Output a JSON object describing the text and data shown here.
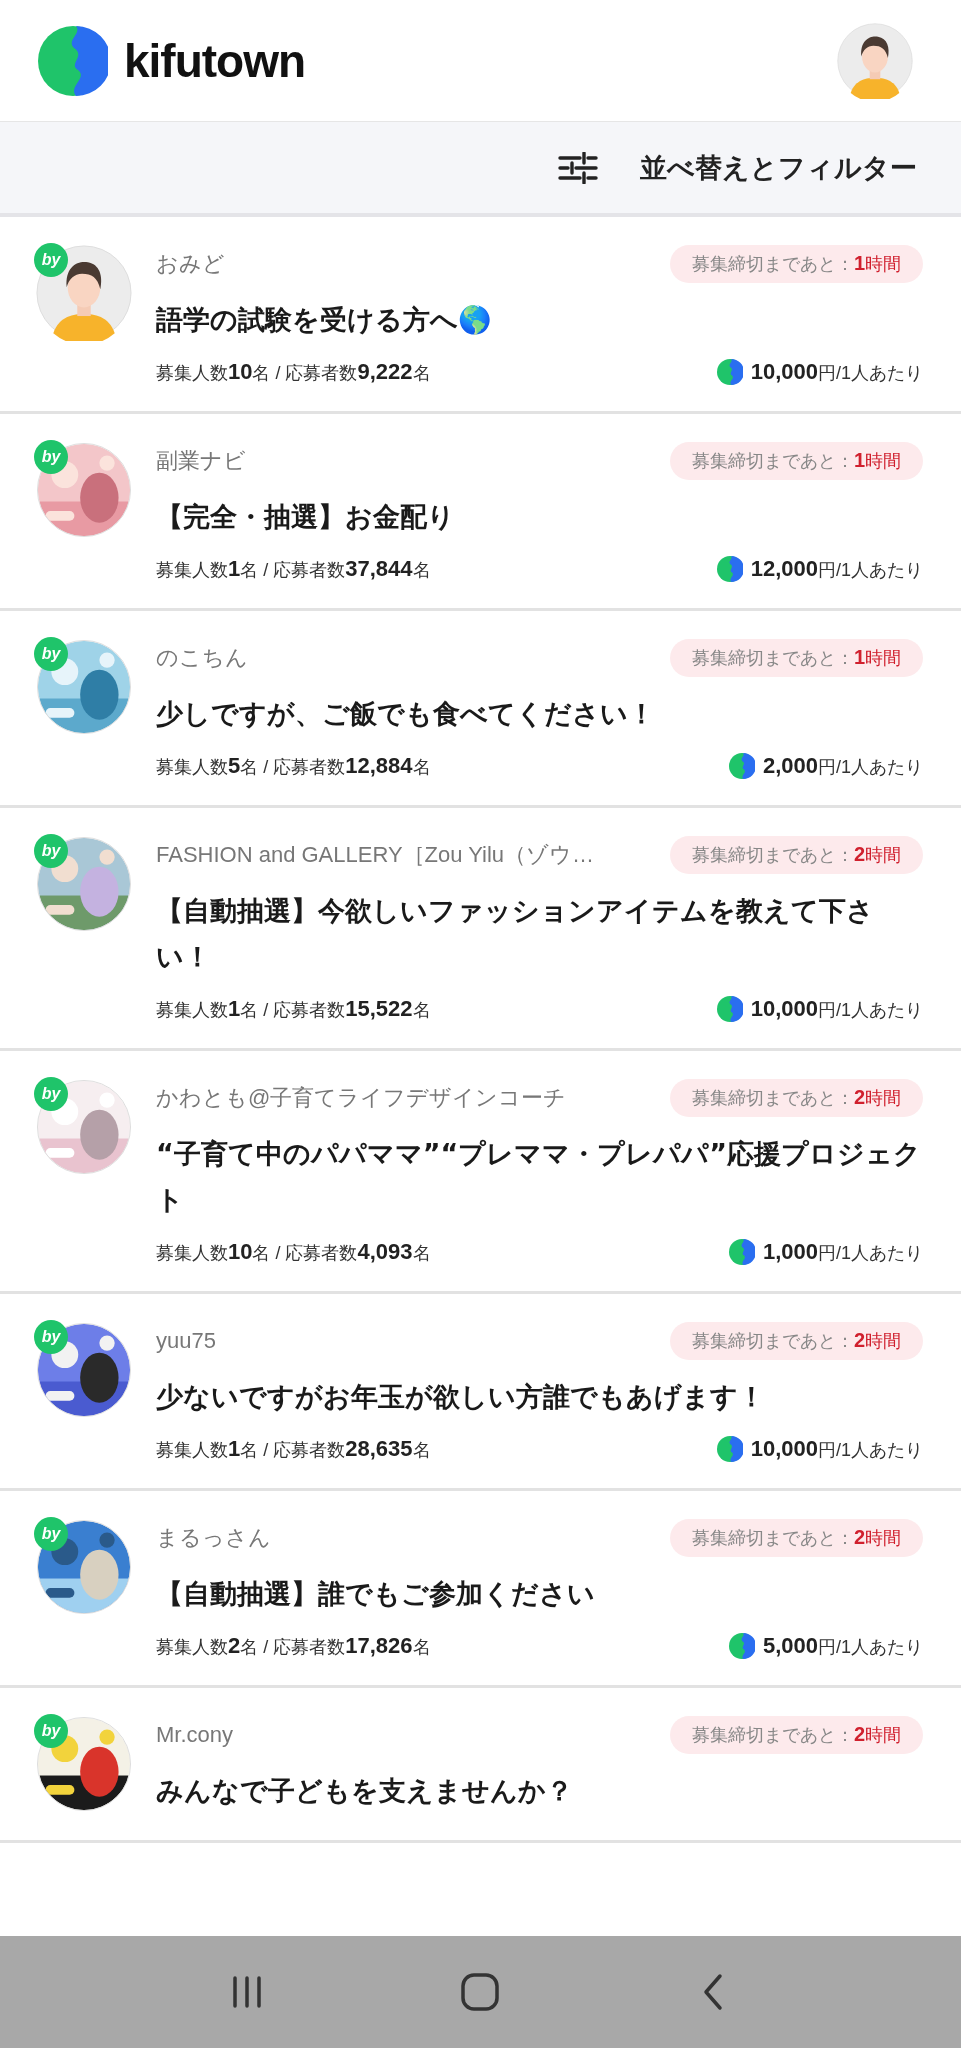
{
  "header": {
    "logo": "kifutown",
    "user_avatar": {
      "kind": "silhouette"
    }
  },
  "filter_bar": {
    "label": "並べ替えとフィルター"
  },
  "projects": [
    {
      "badge": "by",
      "avatar": {
        "kind": "silhouette"
      },
      "name": "おみど",
      "deadline_label": "募集締切まであと：",
      "deadline": "**1**時間",
      "title": "語学の試験を受ける方へ🌎",
      "stats": "募集人数**10**名 / 応募者数**9,222**名",
      "amount": "**10,000**円/1人あたり"
    },
    {
      "badge": "by",
      "name": "副業ナビ",
      "deadline_label": "募集締切まであと：",
      "deadline": "**1**時間",
      "title": "【完全・抽選】お金配り",
      "stats": "募集人数**1**名 / 応募者数**37,844**名",
      "amount": "**12,000**円/1人あたり"
    },
    {
      "badge": "by",
      "name": "のこちん",
      "deadline_label": "募集締切まであと：",
      "deadline": "**1**時間",
      "title": "少しですが、ご飯でも食べてください！",
      "stats": "募集人数**5**名 / 応募者数**12,884**名",
      "amount": "**2,000**円/1人あたり"
    },
    {
      "badge": "by",
      "name": "FASHION and GALLERY［Zou Yilu（ゾウ…",
      "deadline_label": "募集締切まであと：",
      "deadline": "**2**時間",
      "title": "【自動抽選】今欲しいファッションアイテムを教えて下さい！",
      "stats": "募集人数**1**名 / 応募者数**15,522**名",
      "amount": "**10,000**円/1人あたり"
    },
    {
      "badge": "by",
      "name": "かわとも@子育てライフデザインコーチ",
      "deadline_label": "募集締切まであと：",
      "deadline": "**2**時間",
      "title": "“子育て中のパパママ”“プレママ・プレパパ”応援プロジェクト",
      "stats": "募集人数**10**名 / 応募者数**4,093**名",
      "amount": "**1,000**円/1人あたり"
    },
    {
      "badge": "by",
      "name": "yuu75",
      "deadline_label": "募集締切まであと：",
      "deadline": "**2**時間",
      "title": "少ないですがお年玉が欲しい方誰でもあげます！",
      "stats": "募集人数**1**名 / 応募者数**28,635**名",
      "amount": "**10,000**円/1人あたり"
    },
    {
      "badge": "by",
      "name": "まるっさん",
      "deadline_label": "募集締切まであと：",
      "deadline": "**2**時間",
      "title": "【自動抽選】誰でもご参加ください",
      "stats": "募集人数**2**名 / 応募者数**17,826**名",
      "amount": "**5,000**円/1人あたり"
    },
    {
      "badge": "by",
      "name": "Mr.cony",
      "deadline_label": "募集締切まであと：",
      "deadline": "**2**時間",
      "title": "みんなで子どもを支えませんか？"
    }
  ]
}
